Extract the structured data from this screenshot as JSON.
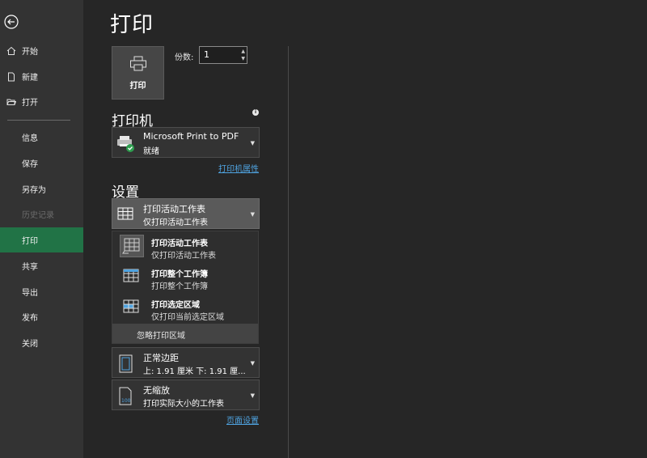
{
  "sidebar": {
    "items": [
      {
        "label": "开始"
      },
      {
        "label": "新建"
      },
      {
        "label": "打开"
      },
      {
        "label": "信息"
      },
      {
        "label": "保存"
      },
      {
        "label": "另存为"
      },
      {
        "label": "历史记录"
      },
      {
        "label": "打印"
      },
      {
        "label": "共享"
      },
      {
        "label": "导出"
      },
      {
        "label": "发布"
      },
      {
        "label": "关闭"
      }
    ],
    "active_item": "打印",
    "active_color": "#217346"
  },
  "page_title": "打印",
  "print_button": {
    "label": "打印"
  },
  "copies": {
    "label": "份数:",
    "value": "1"
  },
  "printer": {
    "heading": "打印机",
    "name": "Microsoft Print to PDF",
    "status": "就绪",
    "properties_link": "打印机属性"
  },
  "settings": {
    "heading": "设置",
    "print_what": {
      "title": "打印活动工作表",
      "subtitle": "仅打印活动工作表"
    },
    "menu": {
      "options": [
        {
          "title": "打印活动工作表",
          "subtitle": "仅打印活动工作表"
        },
        {
          "title": "打印整个工作簿",
          "subtitle": "打印整个工作簿"
        },
        {
          "title": "打印选定区域",
          "subtitle": "仅打印当前选定区域"
        }
      ],
      "ignore_print_area": "忽略打印区域"
    },
    "margins": {
      "title": "正常边距",
      "subtitle": "上: 1.91 厘米 下: 1.91 厘..."
    },
    "scaling": {
      "title": "无缩放",
      "subtitle": "打印实际大小的工作表"
    },
    "page_setup_link": "页面设置"
  },
  "colors": {
    "link": "#4fa3e0",
    "accent": "#217346",
    "check": "#2e9e4f"
  }
}
